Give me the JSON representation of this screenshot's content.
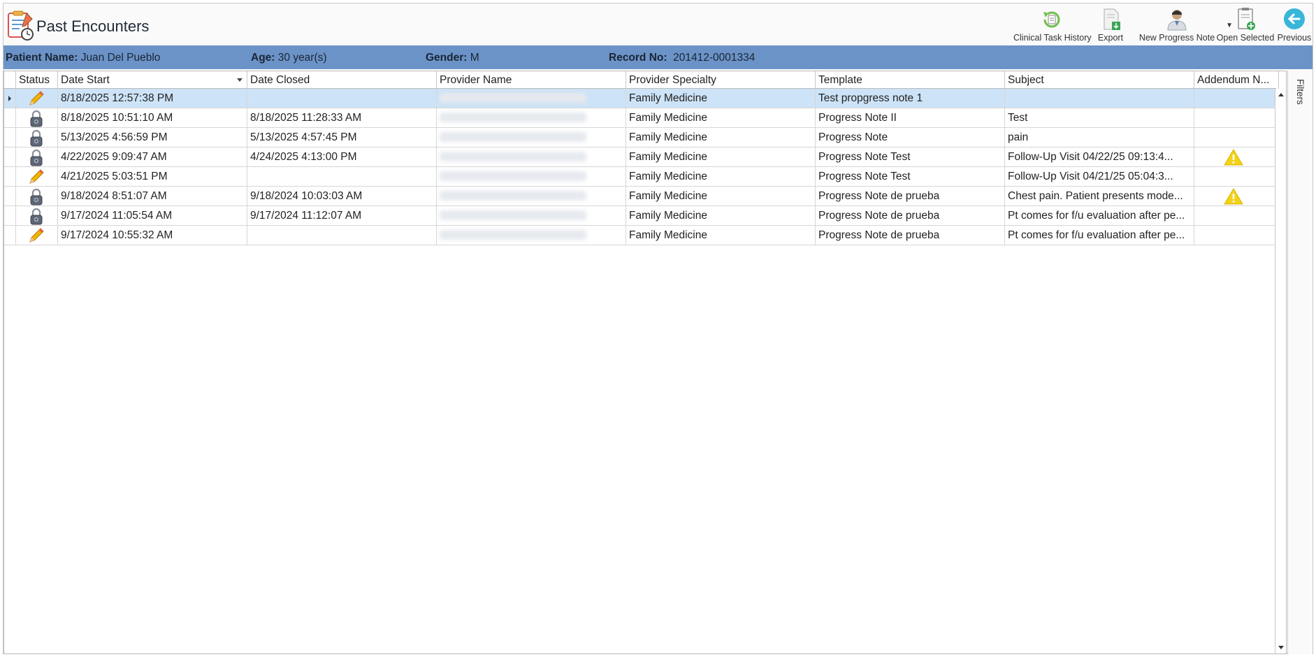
{
  "header": {
    "title": "Past Encounters"
  },
  "toolbar": {
    "clinical_task_history": "Clinical Task History",
    "export": "Export",
    "new_progress_note": "New Progress Note",
    "open_selected": "Open Selected",
    "previous": "Previous"
  },
  "patient": {
    "name_label": "Patient Name:",
    "name": "Juan Del Pueblo",
    "age_label": "Age:",
    "age": "30 year(s)",
    "gender_label": "Gender:",
    "gender": "M",
    "record_label": "Record No:",
    "record": "201412-0001334"
  },
  "grid": {
    "columns": {
      "status": "Status",
      "date_start": "Date Start",
      "date_closed": "Date Closed",
      "provider_name": "Provider Name",
      "provider_specialty": "Provider Specialty",
      "template": "Template",
      "subject": "Subject",
      "addendum": "Addendum N..."
    },
    "rows": [
      {
        "status": "pencil",
        "date_start": "8/18/2025 12:57:38 PM",
        "date_closed": "",
        "specialty": "Family Medicine",
        "template": "Test propgress note 1",
        "subject": "",
        "addendum": false
      },
      {
        "status": "lock",
        "date_start": "8/18/2025 10:51:10 AM",
        "date_closed": "8/18/2025 11:28:33 AM",
        "specialty": "Family Medicine",
        "template": "Progress Note II",
        "subject": "Test",
        "addendum": false
      },
      {
        "status": "lock",
        "date_start": "5/13/2025 4:56:59 PM",
        "date_closed": "5/13/2025 4:57:45 PM",
        "specialty": "Family Medicine",
        "template": "Progress Note",
        "subject": "pain",
        "addendum": false
      },
      {
        "status": "lock",
        "date_start": "4/22/2025 9:09:47 AM",
        "date_closed": "4/24/2025 4:13:00 PM",
        "specialty": "Family Medicine",
        "template": "Progress Note Test",
        "subject": " Follow-Up Visit   04/22/25 09:13:4...",
        "addendum": true
      },
      {
        "status": "pencil",
        "date_start": "4/21/2025 5:03:51 PM",
        "date_closed": "",
        "specialty": "Family Medicine",
        "template": "Progress Note Test",
        "subject": " Follow-Up Visit   04/21/25 05:04:3...",
        "addendum": false
      },
      {
        "status": "lock",
        "date_start": "9/18/2024 8:51:07 AM",
        "date_closed": "9/18/2024 10:03:03 AM",
        "specialty": "Family Medicine",
        "template": "Progress Note de prueba",
        "subject": " Chest pain. Patient presents mode...",
        "addendum": true
      },
      {
        "status": "lock",
        "date_start": "9/17/2024 11:05:54 AM",
        "date_closed": "9/17/2024 11:12:07 AM",
        "specialty": "Family Medicine",
        "template": "Progress Note de prueba",
        "subject": "Pt comes for f/u evaluation after pe...",
        "addendum": false
      },
      {
        "status": "pencil",
        "date_start": "9/17/2024 10:55:32 AM",
        "date_closed": "",
        "specialty": "Family Medicine",
        "template": "Progress Note de prueba",
        "subject": "Pt comes for f/u evaluation after pe...",
        "addendum": false
      }
    ]
  },
  "filters": {
    "label": "Filters"
  },
  "colors": {
    "patient_bar": "#6b93c8",
    "selected_row": "#cde3f7",
    "warning": "#f3d21a"
  }
}
